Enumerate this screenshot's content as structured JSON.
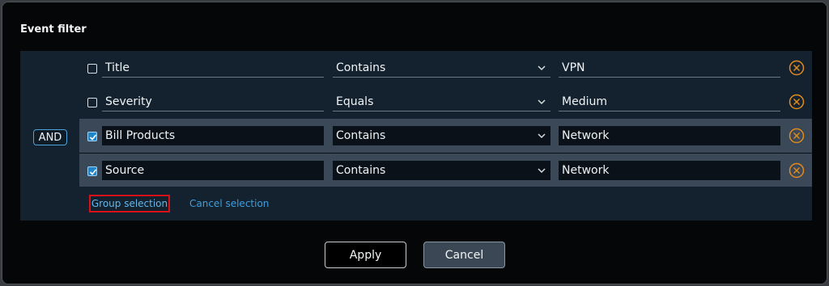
{
  "dialog": {
    "title": "Event filter",
    "operator": "AND",
    "rows": [
      {
        "checked": false,
        "field": "Title",
        "condition": "Contains",
        "value": "VPN"
      },
      {
        "checked": false,
        "field": "Severity",
        "condition": "Equals",
        "value": "Medium"
      },
      {
        "checked": true,
        "field": "Bill Products",
        "condition": "Contains",
        "value": "Network"
      },
      {
        "checked": true,
        "field": "Source",
        "condition": "Contains",
        "value": "Network"
      }
    ],
    "group_selection": "Group selection",
    "cancel_selection": "Cancel selection",
    "apply_label": "Apply",
    "cancel_label": "Cancel"
  },
  "colors": {
    "accent": "#1f86cc",
    "remove_icon": "#e08a1e",
    "highlight_border": "#d8101a",
    "link": "#3f9fe0"
  },
  "icons": {
    "remove": "close-circle-icon",
    "dropdown": "chevron-down-icon",
    "checkbox": "checkmark-icon"
  }
}
